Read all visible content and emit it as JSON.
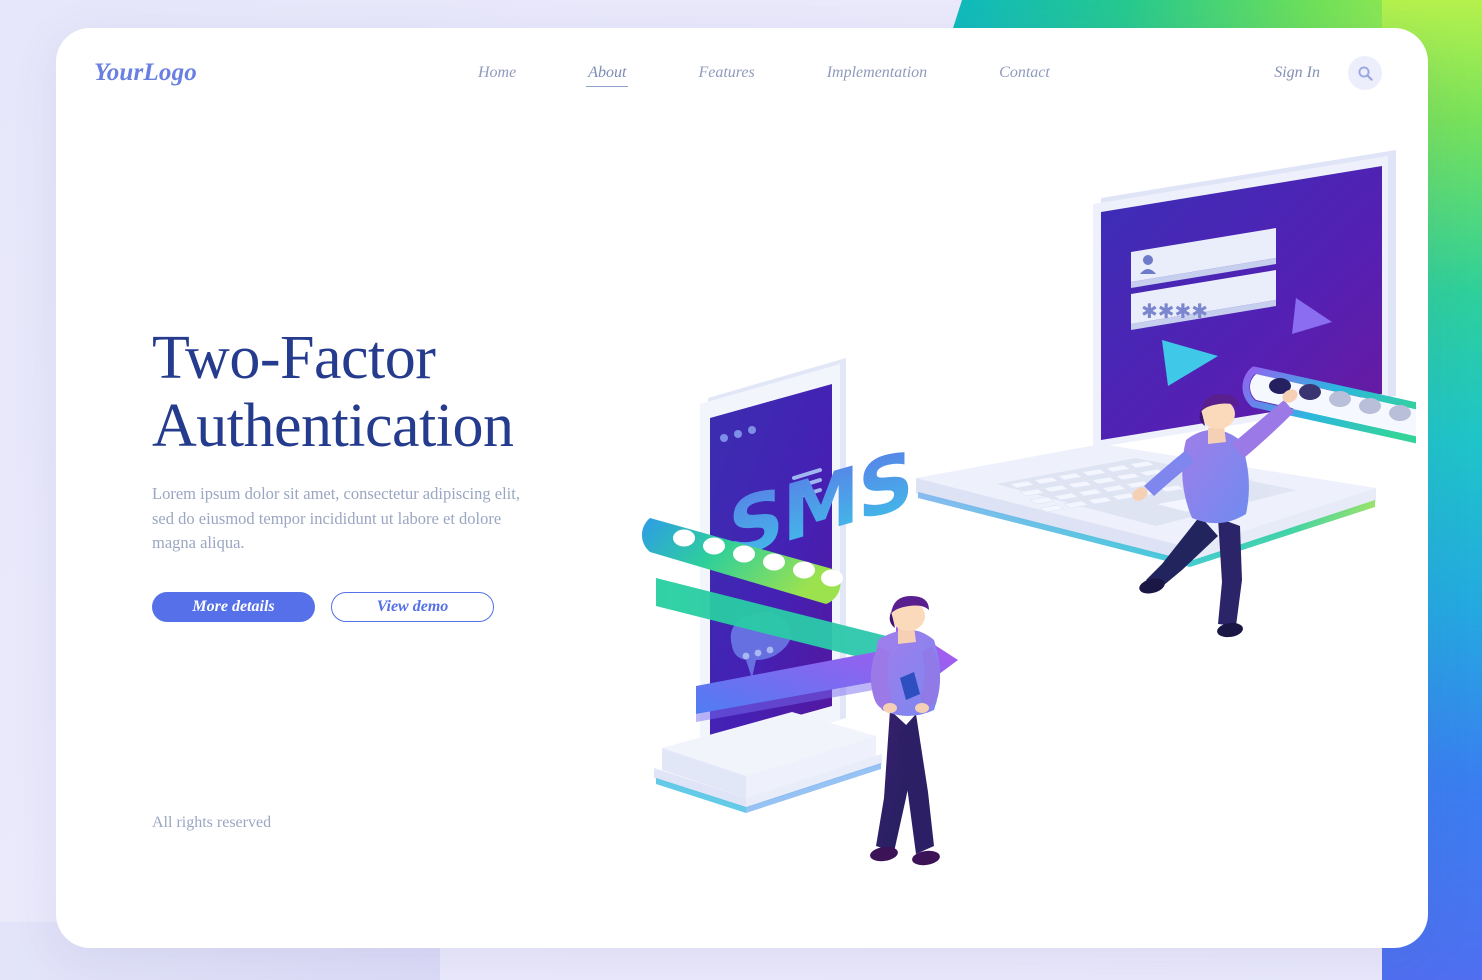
{
  "page": {
    "background_color": "#e8e9fb",
    "card_color": "#ffffff",
    "accent_color": "#5570e8",
    "headline_color": "#253b8e",
    "muted_color": "#9aa6c2"
  },
  "header": {
    "logo": "YourLogo",
    "nav": [
      {
        "label": "Home",
        "active": false
      },
      {
        "label": "About",
        "active": true
      },
      {
        "label": "Features",
        "active": false
      },
      {
        "label": "Implementation",
        "active": false
      },
      {
        "label": "Contact",
        "active": false
      }
    ],
    "signin_label": "Sign In",
    "search_icon": "search-icon"
  },
  "hero": {
    "headline_line1": "Two-Factor",
    "headline_line2": "Authentication",
    "paragraph": "Lorem ipsum dolor sit amet, consectetur adipiscing elit, sed do eiusmod tempor incididunt ut labore et dolore magna aliqua.",
    "primary_button": "More details",
    "secondary_button": "View demo"
  },
  "footer": {
    "rights": "All rights reserved"
  },
  "illustration": {
    "phone": {
      "screen_label": "SMS",
      "icons": [
        "menu-icon",
        "chat-bubble-icon",
        "dots-icon"
      ],
      "passcode_dots": 6,
      "bar_gradient": [
        "#2aa7e8",
        "#2ecf9b",
        "#9ce24f"
      ]
    },
    "laptop": {
      "username_field_icon": "user-icon",
      "password_field_value": "****",
      "arrows": [
        "triangle-down-cyan",
        "triangle-up-purple"
      ],
      "passcode_dots": 6,
      "bar_gradient": [
        "#8f63f0",
        "#2bb6e0",
        "#34d39a"
      ]
    },
    "transfer_arrow": {
      "direction": "phone-to-laptop",
      "gradient": [
        "#2ecf9b",
        "#4f7df2",
        "#a45cf0"
      ]
    },
    "characters": [
      {
        "name": "person-with-phone",
        "sweater_color": "#9b7ae8"
      },
      {
        "name": "person-reaching-passcode",
        "sweater_color": "#8f7ae8"
      }
    ]
  }
}
